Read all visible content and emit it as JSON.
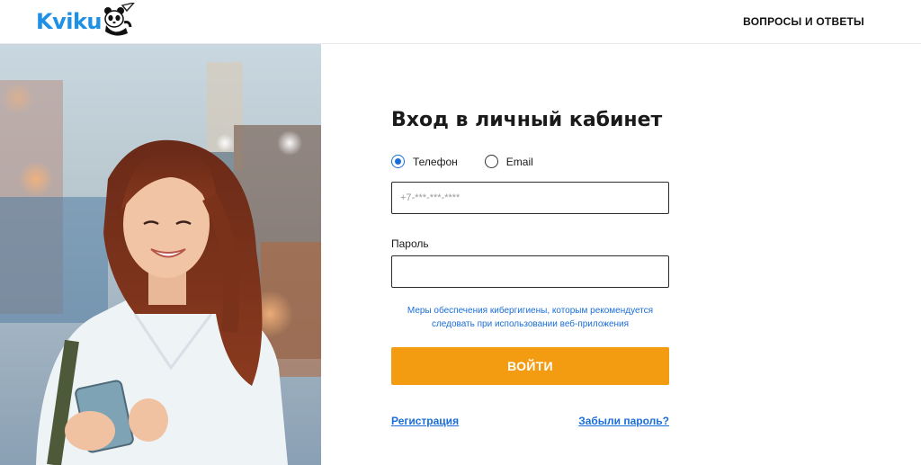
{
  "header": {
    "logo_text": "Kviku",
    "logo_icon": "panda-mascot-icon",
    "faq_label": "ВОПРОСЫ И ОТВЕТЫ"
  },
  "hero": {
    "image": "woman-with-smartphone-photo"
  },
  "form": {
    "title": "Вход в личный кабинет",
    "login_options": [
      {
        "label": "Телефон",
        "checked": true
      },
      {
        "label": "Email",
        "checked": false
      }
    ],
    "phone_placeholder": "+7-***-***-****",
    "phone_value": "",
    "password_label": "Пароль",
    "password_value": "",
    "hint_text": "Меры обеспечения кибергигиены, которым рекомендуется следовать при использовании веб-приложения",
    "submit_label": "ВОЙТИ",
    "register_label": "Регистрация",
    "forgot_label": "Забыли пароль?"
  },
  "colors": {
    "brand": "#1e90e6",
    "accent_button": "#f39c12",
    "link": "#1a6ed8"
  }
}
